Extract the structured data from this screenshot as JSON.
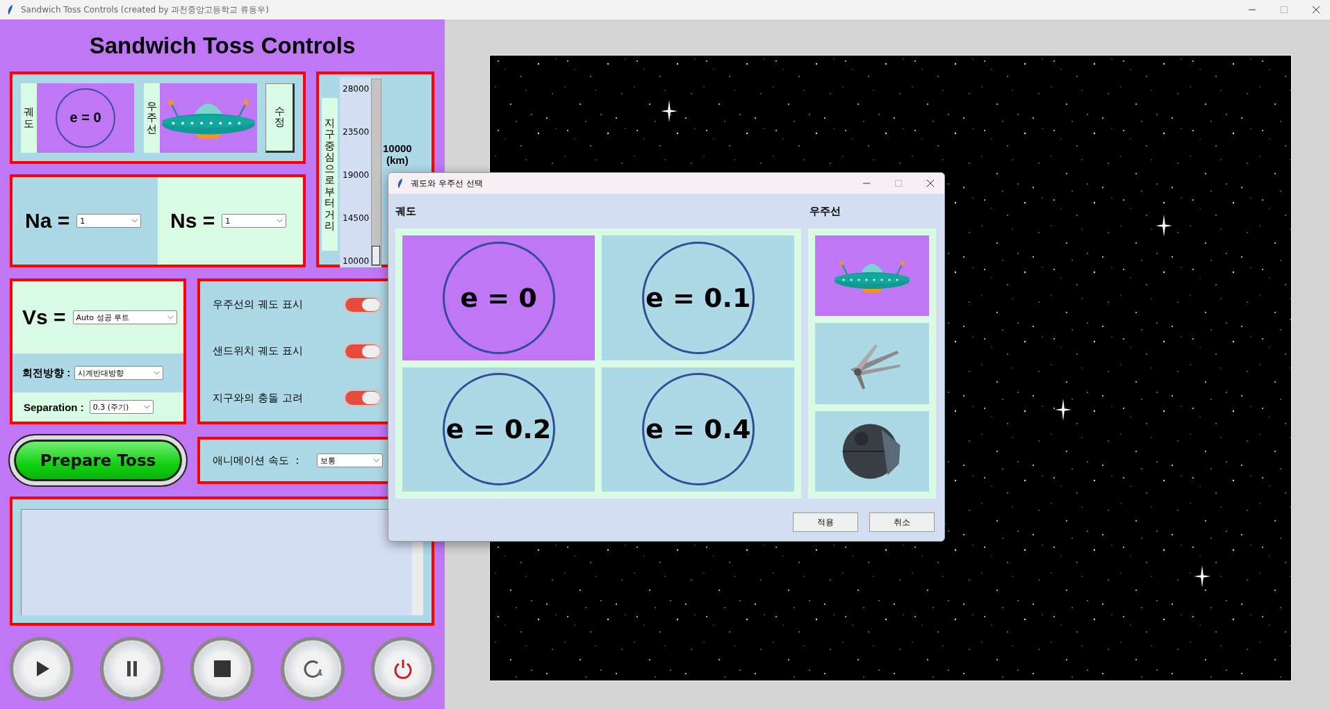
{
  "window": {
    "title": "Sandwich Toss Controls (created by 과천중앙고등학교 류동우)"
  },
  "heading": "Sandwich Toss Controls",
  "preview": {
    "orbit_label": "궤도",
    "orbit_value": "e = 0",
    "ship_label": "우주선",
    "edit_button": "수정"
  },
  "distance": {
    "label": "지구중심으로부터 거리",
    "ticks": [
      "28000",
      "23500",
      "19000",
      "14500",
      "10000"
    ],
    "level": 0,
    "value": "10000",
    "unit": "(km)"
  },
  "counts": [
    {
      "label": "Na =",
      "value": "1"
    },
    {
      "label": "Ns =",
      "value": "1"
    }
  ],
  "velocity": {
    "label": "Vs =",
    "value": "Auto 성공 루트"
  },
  "rotation": {
    "label": "회전방향 :",
    "value": "시계반대방향"
  },
  "separation": {
    "label": "Separation :",
    "value": "0.3 (주기)"
  },
  "toggles": [
    {
      "label": "우주선의 궤도 표시",
      "on": true
    },
    {
      "label": "샌드위치 궤도 표시",
      "on": true
    },
    {
      "label": "지구와의 충돌 고려",
      "on": true
    }
  ],
  "prepare_button": "Prepare Toss",
  "speed": {
    "label": "애니메이션 속도  :",
    "value": "보통"
  },
  "media_buttons": [
    {
      "kind": "play"
    },
    {
      "kind": "pause"
    },
    {
      "kind": "stop"
    },
    {
      "kind": "replay"
    },
    {
      "kind": "power"
    }
  ],
  "dialog": {
    "title": "궤도와 우주선 선택",
    "orbit_heading": "궤도",
    "ship_heading": "우주선",
    "orbits": [
      {
        "label": "e = 0",
        "selected": true
      },
      {
        "label": "e = 0.1",
        "selected": false
      },
      {
        "label": "e = 0.2",
        "selected": false
      },
      {
        "label": "e = 0.4",
        "selected": false
      }
    ],
    "ships": [
      {
        "kind": "saucer",
        "selected": true
      },
      {
        "kind": "fighter",
        "selected": false
      },
      {
        "kind": "sphere",
        "selected": false
      }
    ],
    "buttons": [
      "적용",
      "취소"
    ]
  }
}
